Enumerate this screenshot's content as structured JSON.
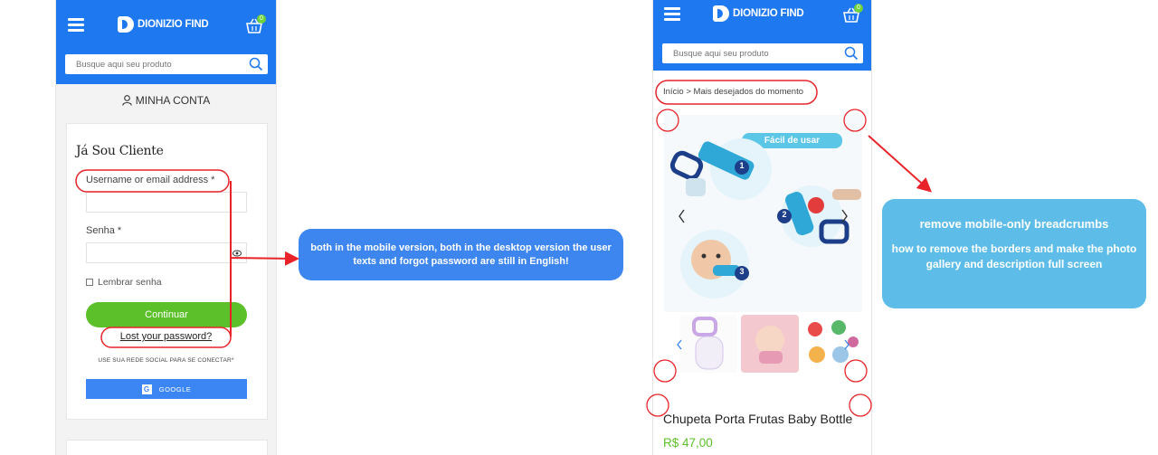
{
  "left_phone": {
    "brand": "DIONIZIO FIND",
    "cart_count": "0",
    "search_placeholder": "Busque aqui seu produto",
    "account_label": "MINHA CONTA",
    "login_title": "Já Sou Cliente",
    "username_label": "Username or email address *",
    "password_label": "Senha *",
    "remember_label": "Lembrar senha",
    "continue_button": "Continuar",
    "lost_password_link": "Lost your password?",
    "social_text": "USE SUA REDE SOCIAL PARA SE CONECTAR*",
    "google_button": "GOOGLE",
    "google_letter": "G"
  },
  "callout_mid": {
    "text": "both in the mobile version, both in the desktop version the user texts and forgot password are still in English!"
  },
  "right_phone": {
    "brand": "DIONIZIO FIND",
    "cart_count": "0",
    "search_placeholder": "Busque aqui seu produto",
    "breadcrumb": "Início > Mais desejados do momento",
    "gallery_badge": "Fácil de usar",
    "gallery_steps": [
      "1",
      "2",
      "3"
    ],
    "product_title": "Chupeta Porta Frutas Baby Bottle",
    "product_price": "R$ 47,00"
  },
  "callout_right": {
    "heading": "remove mobile-only breadcrumbs",
    "body": "how to remove the borders and make the photo gallery and description full screen"
  },
  "colors": {
    "header_blue": "#1e78f0",
    "continue_green": "#5cc02a",
    "google_blue": "#3b86f3",
    "callout_blue": "#3d86f0",
    "callout_cyan": "#5ebde8",
    "annotation_red": "#e8232a"
  }
}
